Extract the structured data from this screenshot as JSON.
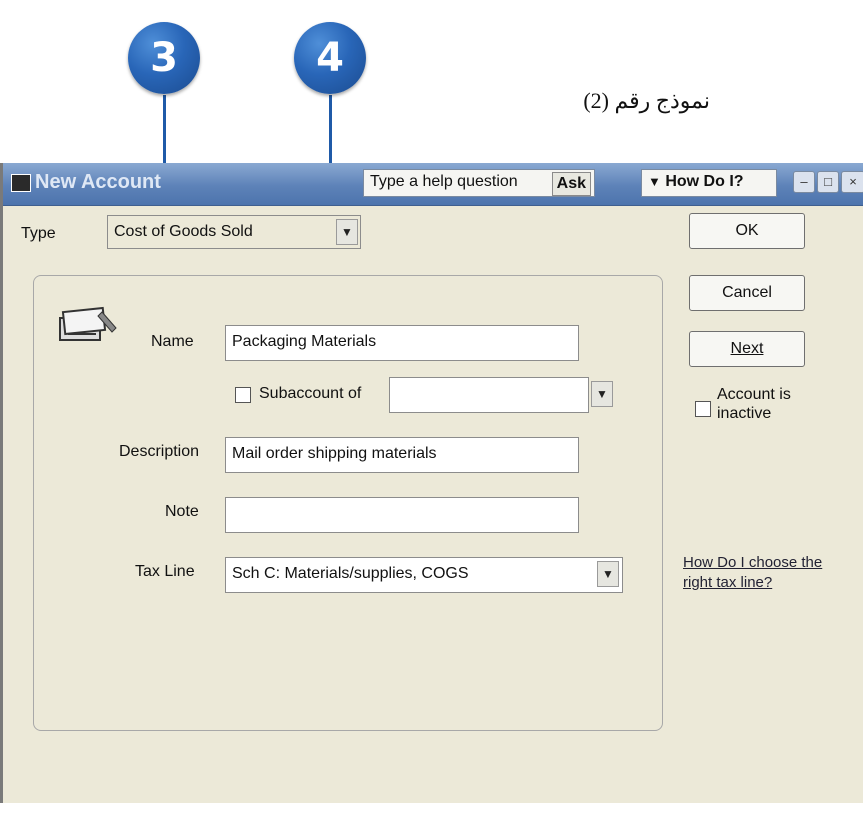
{
  "callouts": [
    "3",
    "4"
  ],
  "caption": "نموذج رقم (2)",
  "window": {
    "title": "New Account",
    "help_placeholder": "Type a help question",
    "ask_label": "Ask",
    "howdoi_label": "How Do I?"
  },
  "form": {
    "type_label": "Type",
    "type_value": "Cost of Goods Sold",
    "name_label": "Name",
    "name_value": "Packaging Materials",
    "subaccount_label": "Subaccount of",
    "subaccount_value": "",
    "subaccount_checked": false,
    "description_label": "Description",
    "description_value": "Mail order shipping materials",
    "note_label": "Note",
    "note_value": "",
    "taxline_label": "Tax Line",
    "taxline_value": "Sch C: Materials/supplies, COGS"
  },
  "buttons": {
    "ok": "OK",
    "cancel": "Cancel",
    "next": "Next"
  },
  "inactive": {
    "label": "Account is inactive",
    "checked": false
  },
  "help_link": "How Do I choose the right tax line?",
  "icons": {
    "titlebar": "window-icon",
    "dropdown": "chevron-down-icon",
    "account": "account-register-icon"
  }
}
